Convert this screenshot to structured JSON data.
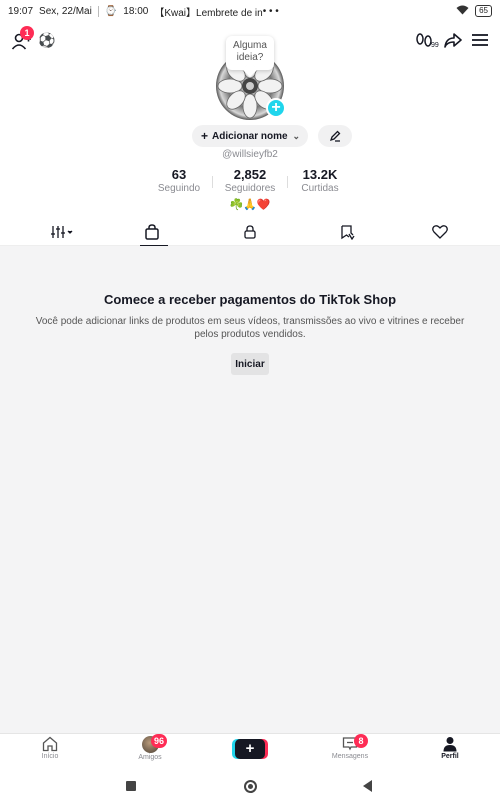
{
  "status_bar": {
    "time": "19:07",
    "date": "Sex, 22/Mai",
    "reminder_time": "18:00",
    "notification": "【Kwai】Lembrete de in",
    "more_dots": "• • •",
    "battery": "65"
  },
  "header": {
    "add_friend_badge": "1",
    "tooltip_line1": "Alguma",
    "tooltip_line2": "ideia?",
    "add_name_label": "Adicionar nome",
    "handle": "@willsieyfb2",
    "stats": [
      {
        "value": "63",
        "label": "Seguindo"
      },
      {
        "value": "2,852",
        "label": "Seguidores"
      },
      {
        "value": "13.2K",
        "label": "Curtidas"
      }
    ],
    "bio": "☘️🙏❤️"
  },
  "tabs": [
    {
      "name": "videos-grid",
      "icon": "sliders-icon"
    },
    {
      "name": "shop",
      "icon": "shopping-bag-icon",
      "active": true
    },
    {
      "name": "private",
      "icon": "lock-icon"
    },
    {
      "name": "reposts",
      "icon": "repost-icon"
    },
    {
      "name": "liked",
      "icon": "heart-icon"
    }
  ],
  "empty_state": {
    "title": "Comece a receber pagamentos do TikTok Shop",
    "description": "Você pode adicionar links de produtos em seus vídeos, transmissões ao vivo e vitrines e receber pelos produtos vendidos.",
    "button": "Iniciar"
  },
  "bottom_nav": {
    "items": [
      {
        "label": "Início",
        "icon": "home-icon"
      },
      {
        "label": "Amigos",
        "icon": "friends-icon",
        "badge": "96"
      },
      {
        "label": "",
        "icon": "plus-icon"
      },
      {
        "label": "Mensagens",
        "icon": "inbox-icon",
        "badge": "8"
      },
      {
        "label": "Perfil",
        "icon": "profile-icon",
        "active": true
      }
    ]
  },
  "colors": {
    "accent_red": "#fe2c55",
    "accent_cyan": "#20d5ec",
    "text_primary": "#161823",
    "text_secondary": "#8a8b91"
  }
}
